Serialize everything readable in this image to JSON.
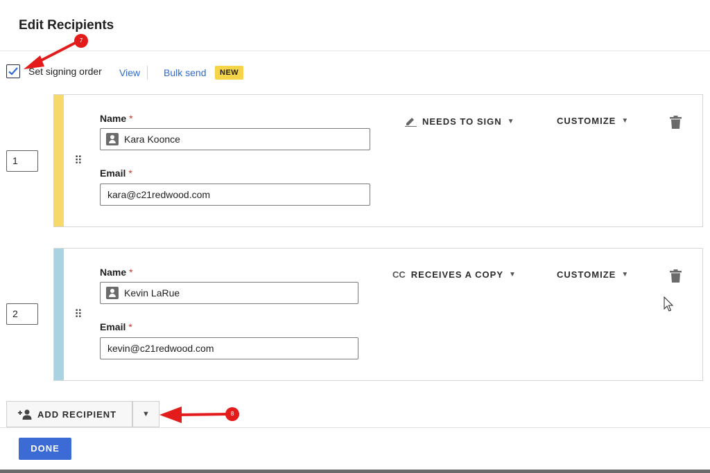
{
  "dialog": {
    "title": "Edit Recipients"
  },
  "signing_order": {
    "label": "Set signing order",
    "checked": true
  },
  "links": {
    "view": "View",
    "bulk_send": "Bulk send",
    "badge": "NEW"
  },
  "recipients": [
    {
      "order": "1",
      "stripe_color": "#f6d86b",
      "name_label": "Name",
      "name_value": "Kara Koonce",
      "email_label": "Email",
      "email_value": "kara@c21redwood.com",
      "required_mark": "*",
      "action": "NEEDS TO SIGN",
      "action_icon": "pen-icon",
      "customize": "CUSTOMIZE"
    },
    {
      "order": "2",
      "stripe_color": "#a9d3e3",
      "name_label": "Name",
      "name_value": "Kevin LaRue",
      "email_label": "Email",
      "email_value": "kevin@c21redwood.com",
      "required_mark": "*",
      "action": "RECEIVES A COPY",
      "action_prefix": "CC",
      "customize": "CUSTOMIZE"
    }
  ],
  "add_recipient": {
    "label": "ADD RECIPIENT"
  },
  "footer": {
    "done": "DONE"
  },
  "annotations": [
    {
      "number": "7",
      "target": "signing-order-checkbox"
    },
    {
      "number": "8",
      "target": "add-recipient-caret"
    }
  ],
  "colors": {
    "accent": "#3d6bd6",
    "link": "#2d6ad2",
    "badge": "#f6d44a",
    "annotation": "#e31b1b"
  }
}
